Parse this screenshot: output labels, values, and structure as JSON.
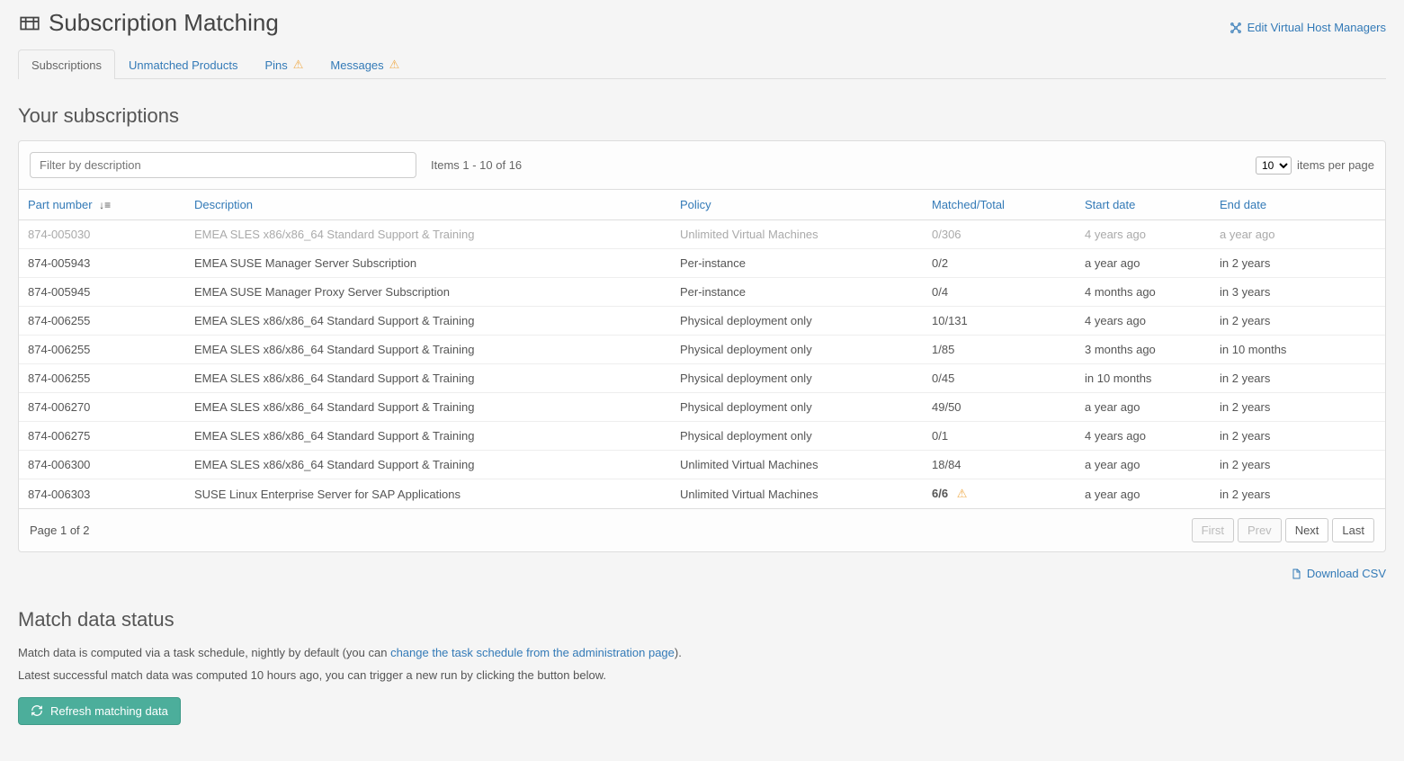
{
  "header": {
    "title": "Subscription Matching",
    "top_link": "Edit Virtual Host Managers"
  },
  "tabs": [
    {
      "label": "Subscriptions",
      "active": true,
      "warn": false
    },
    {
      "label": "Unmatched Products",
      "active": false,
      "warn": false
    },
    {
      "label": "Pins",
      "active": false,
      "warn": true
    },
    {
      "label": "Messages",
      "active": false,
      "warn": true
    }
  ],
  "section_title": "Your subscriptions",
  "filter": {
    "placeholder": "Filter by description",
    "value": ""
  },
  "items_count": "Items 1 - 10 of 16",
  "items_per_page": {
    "value": "10",
    "label": "items per page"
  },
  "columns": {
    "part_number": "Part number",
    "description": "Description",
    "policy": "Policy",
    "matched_total": "Matched/Total",
    "start_date": "Start date",
    "end_date": "End date"
  },
  "rows": [
    {
      "muted": true,
      "warn": false,
      "part": "874-005030",
      "desc": "EMEA SLES x86/x86_64 Standard Support & Training",
      "policy": "Unlimited Virtual Machines",
      "mt": "0/306",
      "start": "4 years ago",
      "end": "a year ago"
    },
    {
      "muted": false,
      "warn": false,
      "part": "874-005943",
      "desc": "EMEA SUSE Manager Server Subscription",
      "policy": "Per-instance",
      "mt": "0/2",
      "start": "a year ago",
      "end": "in 2 years"
    },
    {
      "muted": false,
      "warn": false,
      "part": "874-005945",
      "desc": "EMEA SUSE Manager Proxy Server Subscription",
      "policy": "Per-instance",
      "mt": "0/4",
      "start": "4 months ago",
      "end": "in 3 years"
    },
    {
      "muted": false,
      "warn": false,
      "part": "874-006255",
      "desc": "EMEA SLES x86/x86_64 Standard Support & Training",
      "policy": "Physical deployment only",
      "mt": "10/131",
      "start": "4 years ago",
      "end": "in 2 years"
    },
    {
      "muted": false,
      "warn": false,
      "part": "874-006255",
      "desc": "EMEA SLES x86/x86_64 Standard Support & Training",
      "policy": "Physical deployment only",
      "mt": "1/85",
      "start": "3 months ago",
      "end": "in 10 months"
    },
    {
      "muted": false,
      "warn": false,
      "part": "874-006255",
      "desc": "EMEA SLES x86/x86_64 Standard Support & Training",
      "policy": "Physical deployment only",
      "mt": "0/45",
      "start": "in 10 months",
      "end": "in 2 years"
    },
    {
      "muted": false,
      "warn": false,
      "part": "874-006270",
      "desc": "EMEA SLES x86/x86_64 Standard Support & Training",
      "policy": "Physical deployment only",
      "mt": "49/50",
      "start": "a year ago",
      "end": "in 2 years"
    },
    {
      "muted": false,
      "warn": false,
      "part": "874-006275",
      "desc": "EMEA SLES x86/x86_64 Standard Support & Training",
      "policy": "Physical deployment only",
      "mt": "0/1",
      "start": "4 years ago",
      "end": "in 2 years"
    },
    {
      "muted": false,
      "warn": false,
      "part": "874-006300",
      "desc": "EMEA SLES x86/x86_64 Standard Support & Training",
      "policy": "Unlimited Virtual Machines",
      "mt": "18/84",
      "start": "a year ago",
      "end": "in 2 years"
    },
    {
      "muted": false,
      "warn": true,
      "part": "874-006303",
      "desc": "SUSE Linux Enterprise Server for SAP Applications",
      "policy": "Unlimited Virtual Machines",
      "mt": "6/6",
      "start": "a year ago",
      "end": "in 2 years"
    }
  ],
  "pagination": {
    "page_label": "Page 1 of 2",
    "first": "First",
    "prev": "Prev",
    "next": "Next",
    "last": "Last"
  },
  "csv_link": "Download CSV",
  "status": {
    "title": "Match data status",
    "line1_a": "Match data is computed via a task schedule, nightly by default (you can ",
    "line1_link": "change the task schedule from the administration page",
    "line1_b": ").",
    "line2": "Latest successful match data was computed 10 hours ago, you can trigger a new run by clicking the button below.",
    "button": "Refresh matching data"
  }
}
